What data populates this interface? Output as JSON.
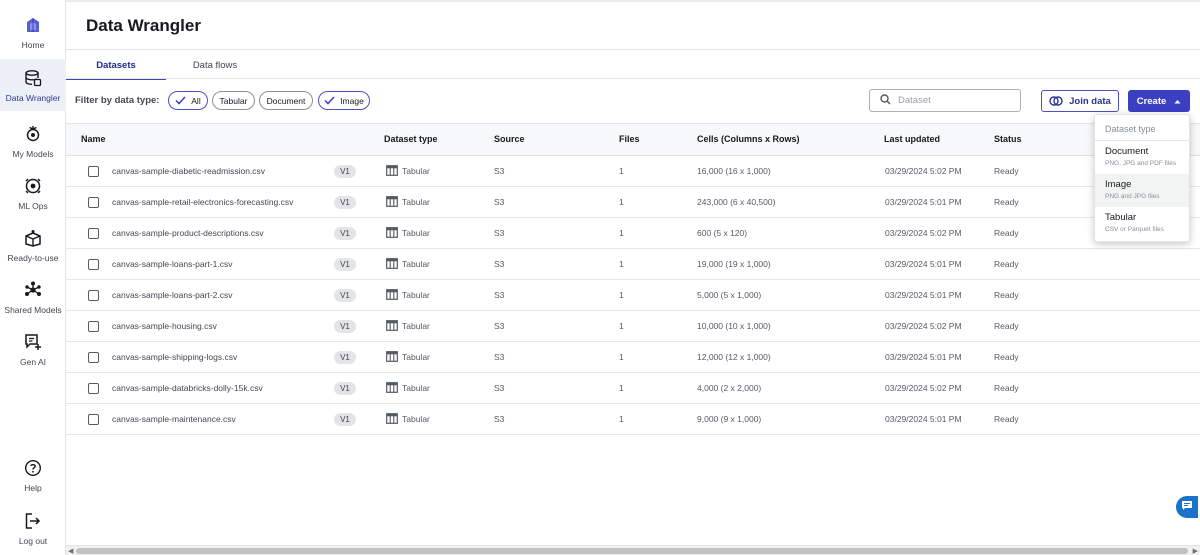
{
  "sidebar": {
    "items": [
      {
        "label": "Home",
        "icon": "home-logo-icon"
      },
      {
        "label": "Data Wrangler",
        "icon": "database-icon"
      },
      {
        "label": "My Models",
        "icon": "models-icon"
      },
      {
        "label": "ML Ops",
        "icon": "ml-ops-icon"
      },
      {
        "label": "Ready-to-use",
        "icon": "package-icon"
      },
      {
        "label": "Shared Models",
        "icon": "shared-models-icon"
      },
      {
        "label": "Gen AI",
        "icon": "gen-ai-icon"
      }
    ],
    "bottom": [
      {
        "label": "Help",
        "icon": "help-icon"
      },
      {
        "label": "Log out",
        "icon": "logout-icon"
      }
    ]
  },
  "header": {
    "title": "Data Wrangler"
  },
  "tabs": [
    {
      "label": "Datasets",
      "active": true
    },
    {
      "label": "Data flows",
      "active": false
    }
  ],
  "filter": {
    "label": "Filter by data type:",
    "chips": [
      {
        "label": "All",
        "selected": true
      },
      {
        "label": "Tabular",
        "selected": false
      },
      {
        "label": "Document",
        "selected": false
      },
      {
        "label": "Image",
        "selected": true
      }
    ]
  },
  "search": {
    "placeholder": "Dataset",
    "value": ""
  },
  "actions": {
    "join_label": "Join data",
    "create_label": "Create"
  },
  "table": {
    "columns": [
      "Name",
      "Dataset type",
      "Source",
      "Files",
      "Cells (Columns x Rows)",
      "Last updated",
      "Status"
    ],
    "rows": [
      {
        "name": "canvas-sample-diabetic-readmission.csv",
        "version": "V1",
        "type": "Tabular",
        "source": "S3",
        "files": "1",
        "cells": "16,000 (16 x 1,000)",
        "updated": "03/29/2024 5:02 PM",
        "status": "Ready"
      },
      {
        "name": "canvas-sample-retail-electronics-forecasting.csv",
        "version": "V1",
        "type": "Tabular",
        "source": "S3",
        "files": "1",
        "cells": "243,000 (6 x 40,500)",
        "updated": "03/29/2024 5:01 PM",
        "status": "Ready"
      },
      {
        "name": "canvas-sample-product-descriptions.csv",
        "version": "V1",
        "type": "Tabular",
        "source": "S3",
        "files": "1",
        "cells": "600 (5 x 120)",
        "updated": "03/29/2024 5:02 PM",
        "status": "Ready"
      },
      {
        "name": "canvas-sample-loans-part-1.csv",
        "version": "V1",
        "type": "Tabular",
        "source": "S3",
        "files": "1",
        "cells": "19,000 (19 x 1,000)",
        "updated": "03/29/2024 5:01 PM",
        "status": "Ready"
      },
      {
        "name": "canvas-sample-loans-part-2.csv",
        "version": "V1",
        "type": "Tabular",
        "source": "S3",
        "files": "1",
        "cells": "5,000 (5 x 1,000)",
        "updated": "03/29/2024 5:01 PM",
        "status": "Ready"
      },
      {
        "name": "canvas-sample-housing.csv",
        "version": "V1",
        "type": "Tabular",
        "source": "S3",
        "files": "1",
        "cells": "10,000 (10 x 1,000)",
        "updated": "03/29/2024 5:02 PM",
        "status": "Ready"
      },
      {
        "name": "canvas-sample-shipping-logs.csv",
        "version": "V1",
        "type": "Tabular",
        "source": "S3",
        "files": "1",
        "cells": "12,000 (12 x 1,000)",
        "updated": "03/29/2024 5:01 PM",
        "status": "Ready"
      },
      {
        "name": "canvas-sample-databricks-dolly-15k.csv",
        "version": "V1",
        "type": "Tabular",
        "source": "S3",
        "files": "1",
        "cells": "4,000 (2 x 2,000)",
        "updated": "03/29/2024 5:02 PM",
        "status": "Ready"
      },
      {
        "name": "canvas-sample-maintenance.csv",
        "version": "V1",
        "type": "Tabular",
        "source": "S3",
        "files": "1",
        "cells": "9,000 (9 x 1,000)",
        "updated": "03/29/2024 5:01 PM",
        "status": "Ready"
      }
    ]
  },
  "dropdown": {
    "header": "Dataset type",
    "items": [
      {
        "title": "Document",
        "subtitle": "PNG, JPG and PDF files"
      },
      {
        "title": "Image",
        "subtitle": "PNG and JPG files"
      },
      {
        "title": "Tabular",
        "subtitle": "CSV or Parquet files"
      }
    ]
  },
  "colors": {
    "accent": "#3b3fc1",
    "active_bg": "#eef0f8",
    "chat": "#1a73c8"
  }
}
